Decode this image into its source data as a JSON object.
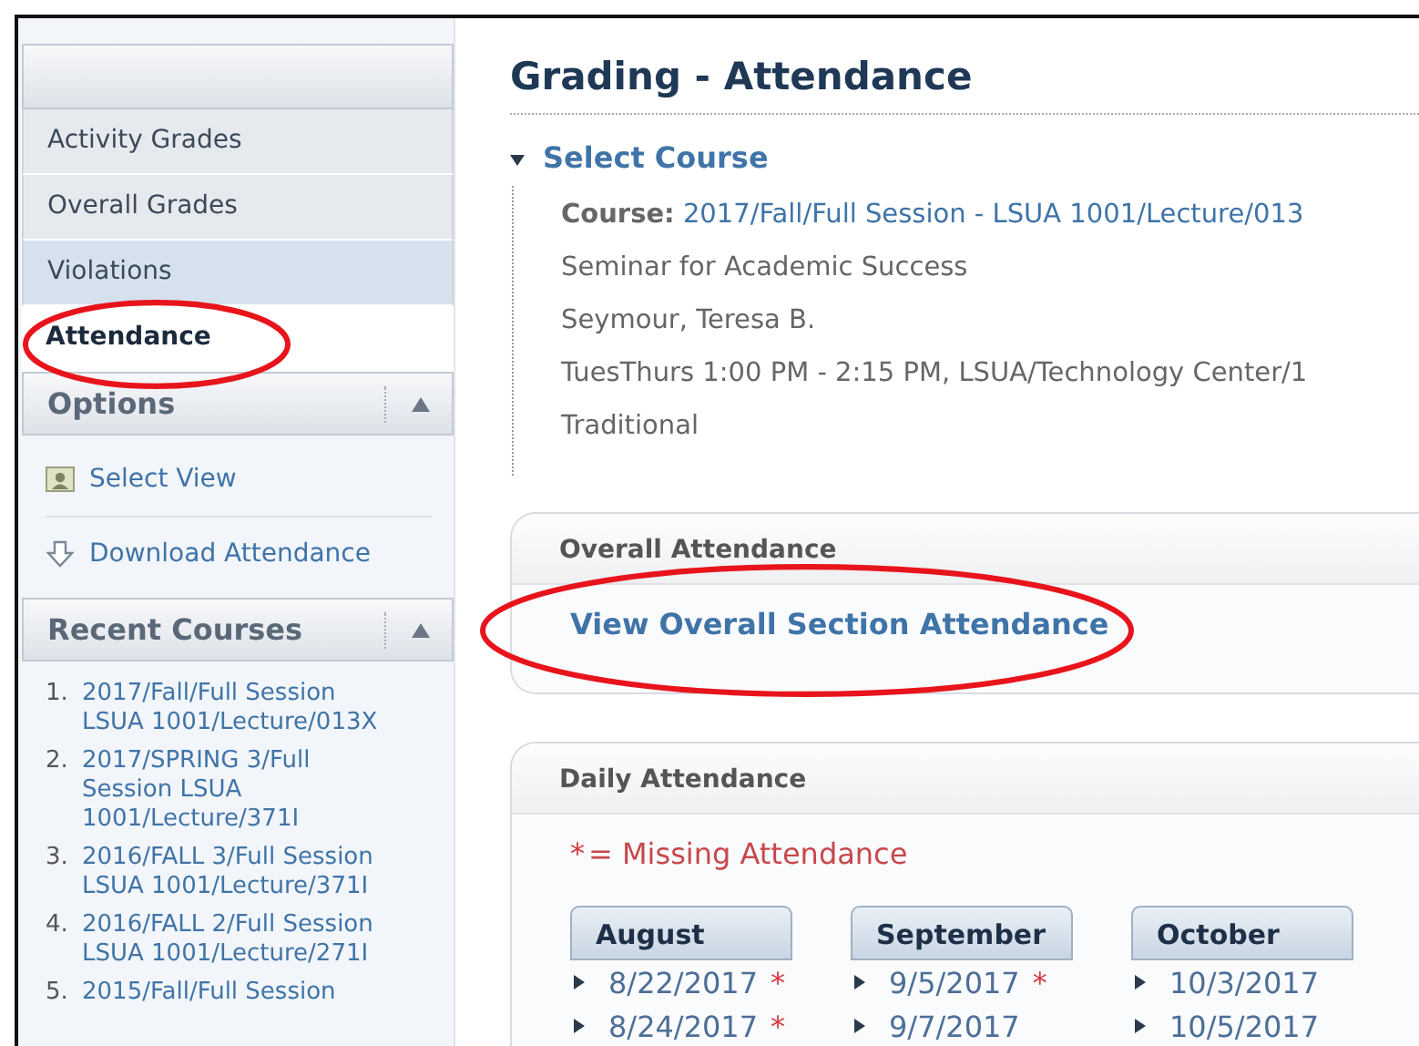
{
  "sidebar": {
    "nav_items": [
      {
        "label": "Activity Grades",
        "selected": false,
        "hovered": false,
        "circled": false
      },
      {
        "label": "Overall Grades",
        "selected": false,
        "hovered": false,
        "circled": false
      },
      {
        "label": "Violations",
        "selected": false,
        "hovered": true,
        "circled": false
      },
      {
        "label": "Attendance",
        "selected": true,
        "hovered": false,
        "circled": true
      }
    ],
    "options": {
      "title": "Options",
      "expanded": true,
      "items": [
        {
          "label": "Select View",
          "kind": "view"
        },
        {
          "label": "Download Attendance",
          "kind": "download"
        }
      ]
    },
    "recent_courses": {
      "title": "Recent Courses",
      "expanded": true,
      "items": [
        {
          "number": "1.",
          "label": "2017/Fall/Full Session LSUA 1001/Lecture/013X"
        },
        {
          "number": "2.",
          "label": "2017/SPRING 3/Full Session LSUA 1001/Lecture/371I"
        },
        {
          "number": "3.",
          "label": "2016/FALL 3/Full Session LSUA 1001/Lecture/371I"
        },
        {
          "number": "4.",
          "label": "2016/FALL 2/Full Session LSUA 1001/Lecture/271I"
        },
        {
          "number": "5.",
          "label": "2015/Fall/Full Session"
        }
      ]
    }
  },
  "main": {
    "title": "Grading - Attendance",
    "select_course": {
      "label": "Select Course",
      "expanded": true,
      "course_label": "Course:",
      "course": "2017/Fall/Full Session - LSUA 1001/Lecture/013",
      "details": [
        "Seminar for Academic Success",
        "Seymour, Teresa B.",
        "TuesThurs 1:00 PM - 2:15 PM, LSUA/Technology Center/1",
        "Traditional"
      ]
    },
    "overall_attendance": {
      "title": "Overall Attendance",
      "link": "View Overall Section Attendance",
      "circled": true
    },
    "daily_attendance": {
      "title": "Daily Attendance",
      "legend_mark": "*",
      "legend": "= Missing Attendance",
      "months": [
        {
          "name": "August",
          "dates": [
            {
              "date": "8/22/2017",
              "missing": true
            },
            {
              "date": "8/24/2017",
              "missing": true
            }
          ]
        },
        {
          "name": "September",
          "dates": [
            {
              "date": "9/5/2017",
              "missing": true
            },
            {
              "date": "9/7/2017",
              "missing": false
            }
          ]
        },
        {
          "name": "October",
          "dates": [
            {
              "date": "10/3/2017",
              "missing": false
            },
            {
              "date": "10/5/2017",
              "missing": false
            }
          ]
        }
      ]
    }
  }
}
